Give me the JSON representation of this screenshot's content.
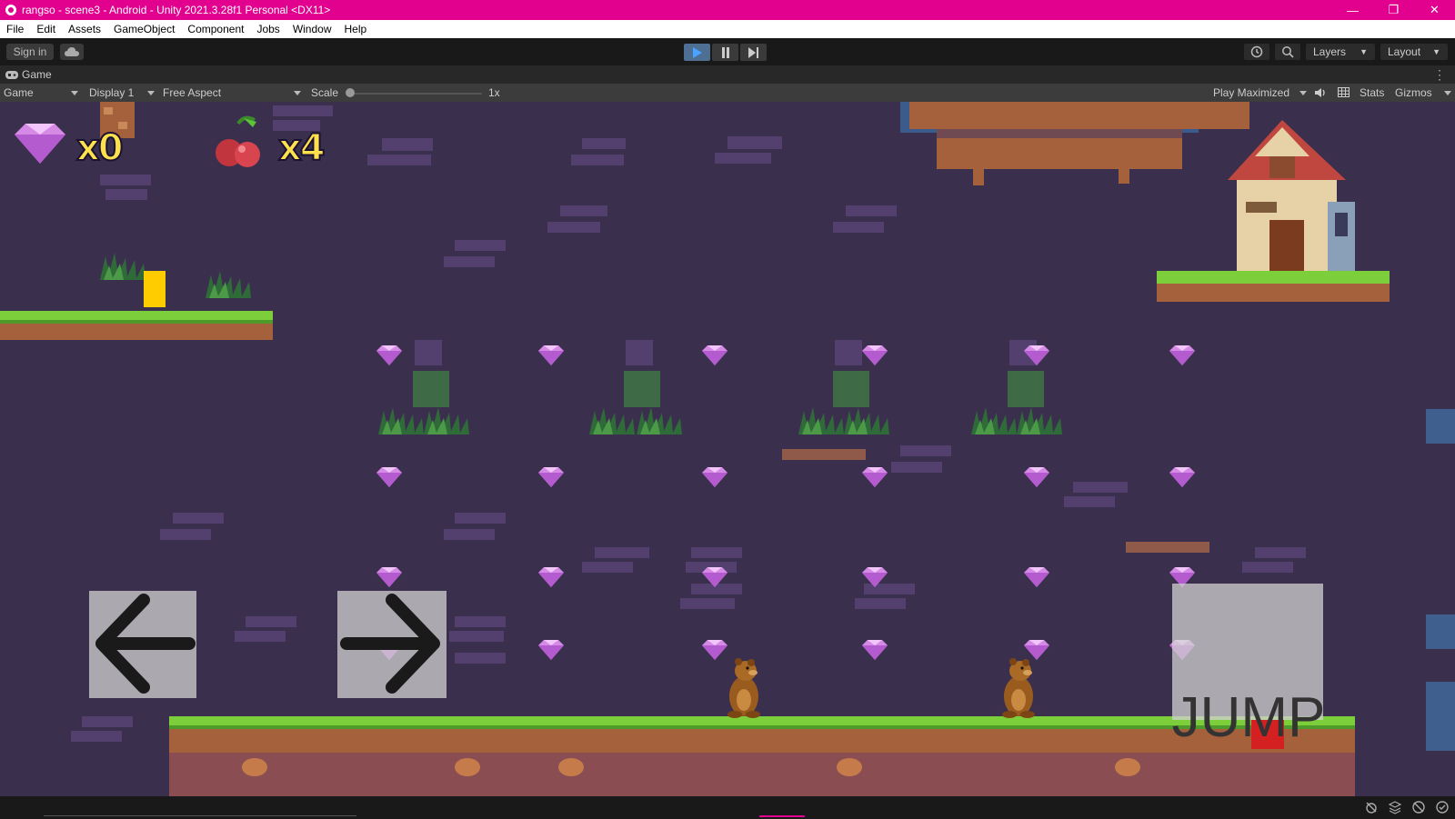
{
  "window": {
    "title": "rangso - scene3 - Android - Unity 2021.3.28f1 Personal <DX11>",
    "controls": {
      "minimize": "—",
      "restore": "❐",
      "close": "✕"
    }
  },
  "menu": [
    "File",
    "Edit",
    "Assets",
    "GameObject",
    "Component",
    "Jobs",
    "Window",
    "Help"
  ],
  "toolbar": {
    "sign_in": "Sign in",
    "layers": "Layers",
    "layout": "Layout",
    "play_state": "playing"
  },
  "game_tab": {
    "label": "Game"
  },
  "game_toolbar": {
    "view_mode": "Game",
    "display": "Display 1",
    "aspect": "Free Aspect",
    "scale_label": "Scale",
    "scale_value": "1x",
    "play_mode": "Play Maximized",
    "stats": "Stats",
    "gizmos": "Gizmos"
  },
  "game": {
    "hud": {
      "gem_count": "x0",
      "cherry_count": "x4"
    },
    "controls": {
      "jump_label": "JUMP"
    },
    "colors": {
      "background": "#3b2f4e",
      "gem": "#d58be6",
      "grass": "#7ccf3a",
      "dirt": "#a5603c",
      "hud_text": "#ffe14d"
    }
  }
}
